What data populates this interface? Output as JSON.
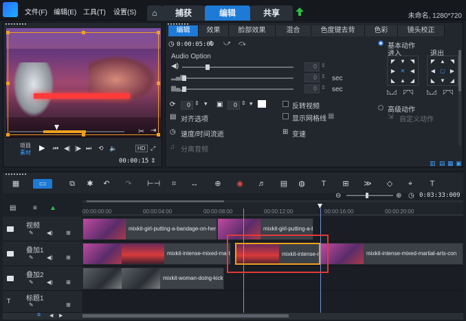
{
  "menu": {
    "file": "文件(F)",
    "edit": "编辑(E)",
    "tools": "工具(T)",
    "settings": "设置(S)"
  },
  "tabs": {
    "capture": "捕获",
    "edit": "编辑",
    "share": "共享"
  },
  "project_info": "未命名, 1280*720",
  "preview": {
    "project_label": "项目",
    "clip_label": "素材",
    "timecode": "00:00:15",
    "quality": "HD"
  },
  "options": {
    "tabs": [
      "编辑",
      "效果",
      "脸部效果",
      "混合",
      "色度键去背",
      "色彩",
      "镜头校正"
    ],
    "duration": "0:00:05:09",
    "audio_option": "Audio Option",
    "audio_values": [
      "0",
      "0",
      "0"
    ],
    "sec": "sec",
    "rotate_value": "0",
    "border_value": "0",
    "reverse_video": "反转视频",
    "show_grid": "显示网格线",
    "align_options": "对齐选项",
    "speed_time": "速度/时间流逝",
    "variable_speed": "变速",
    "split_audio": "分离音频",
    "basic_motion": "基本动作",
    "enter": "进入",
    "exit": "退出",
    "advanced_motion": "高级动作",
    "custom_motion": "自定义动作"
  },
  "timeline": {
    "ruler": [
      "00:00:00:00",
      "00:00:04:00",
      "00:00:08:00",
      "00:00:12:00",
      "00:00:16:00",
      "00:00:20:00"
    ],
    "total_time": "0:03:33:009",
    "tracks": [
      {
        "name": "视频",
        "icon": "video-track-icon"
      },
      {
        "name": "叠加1",
        "icon": "overlay-track-icon"
      },
      {
        "name": "叠加2",
        "icon": "overlay-track-icon"
      },
      {
        "name": "标题1",
        "icon": "title-track-icon"
      }
    ],
    "clips": {
      "video1": "mixkit-girl-putting-a-bandage-on-her-h",
      "video2": "mixkit-girl-putting-a-ba",
      "overlay1": "mixkit-intense-mixed-martial-",
      "overlay2": "mixkit-intense-mixed-martial-a",
      "overlay3": "mixkit-intense-mixed-martial-arts-con",
      "overlay2_1": "mixkit-woman-doing-kickb"
    }
  },
  "colors": {
    "accent": "#1d7ad6",
    "highlight_box": "#e03a3a",
    "playhead": "#e58a1a",
    "selection": "#f0a020"
  }
}
